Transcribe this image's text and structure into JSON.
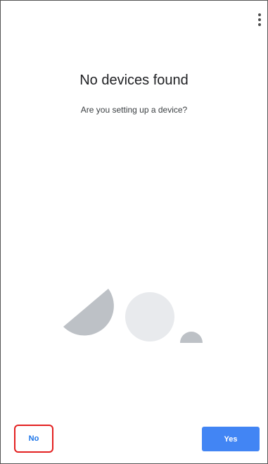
{
  "menu": {
    "icon": "more-vert-icon"
  },
  "heading": {
    "title": "No devices found",
    "subtitle": "Are you setting up a device?"
  },
  "illustration": {
    "icon": "device-shapes-illustration",
    "colors": {
      "dark_shape": "#bdc1c6",
      "light_shape": "#e8eaed"
    }
  },
  "actions": {
    "no_label": "No",
    "yes_label": "Yes"
  },
  "colors": {
    "primary": "#4285f4",
    "link_text": "#1a73e8",
    "highlight_border": "#e32020"
  }
}
